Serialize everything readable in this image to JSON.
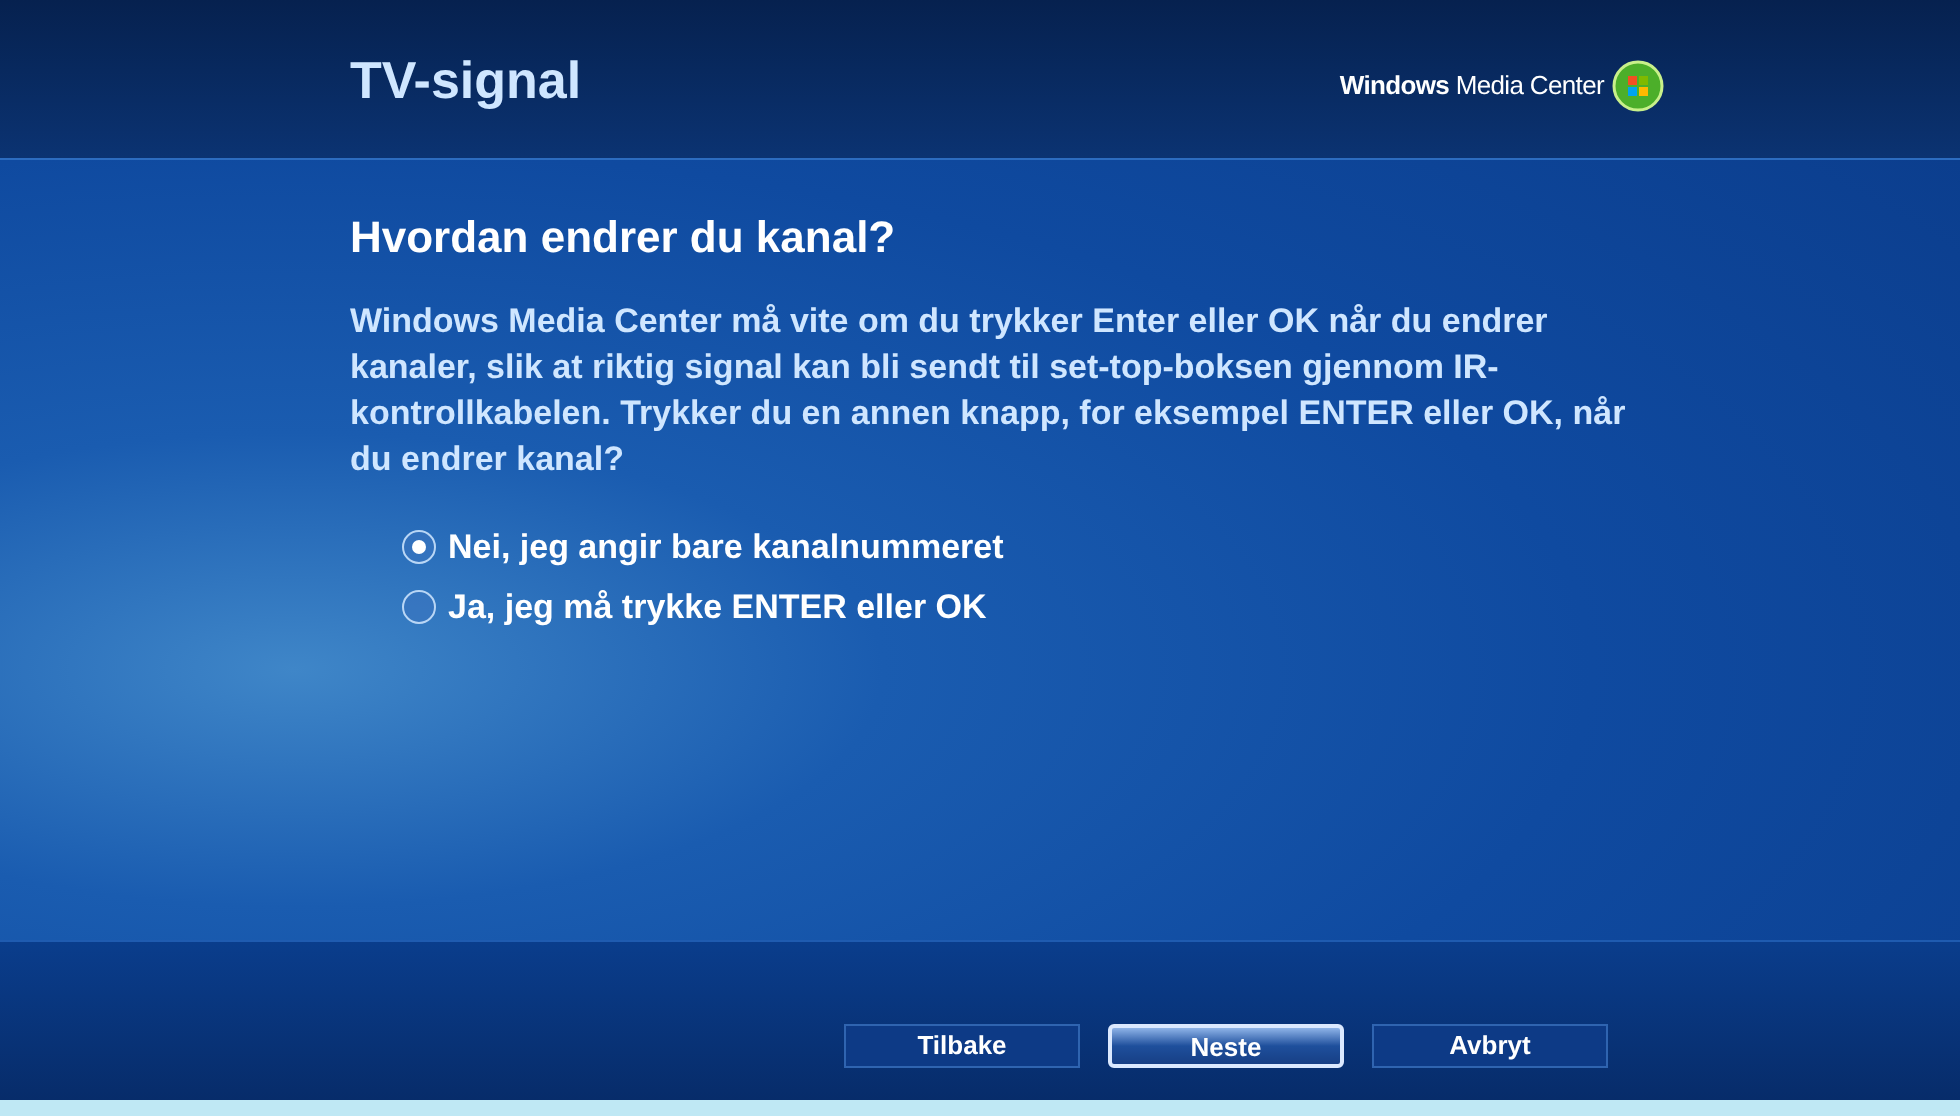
{
  "header": {
    "title": "TV-signal",
    "brand": "**Windows** Media Center"
  },
  "heading": "Hvordan endrer du kanal?",
  "description": "Windows Media Center må vite om du trykker Enter eller OK når du endrer kanaler, slik at riktig signal kan bli sendt til set-top-boksen gjennom IR-kontrollkabelen. Trykker du en annen knapp, for eksempel ENTER eller OK, når du endrer kanal?",
  "options": [
    {
      "label": "Nei, jeg angir bare kanalnummeret",
      "selected": true
    },
    {
      "label": "Ja, jeg må trykke ENTER eller OK",
      "selected": false
    }
  ],
  "buttons": [
    {
      "label": "Tilbake",
      "focused": false
    },
    {
      "label": "Neste",
      "focused": true
    },
    {
      "label": "Avbryt",
      "focused": false
    }
  ]
}
